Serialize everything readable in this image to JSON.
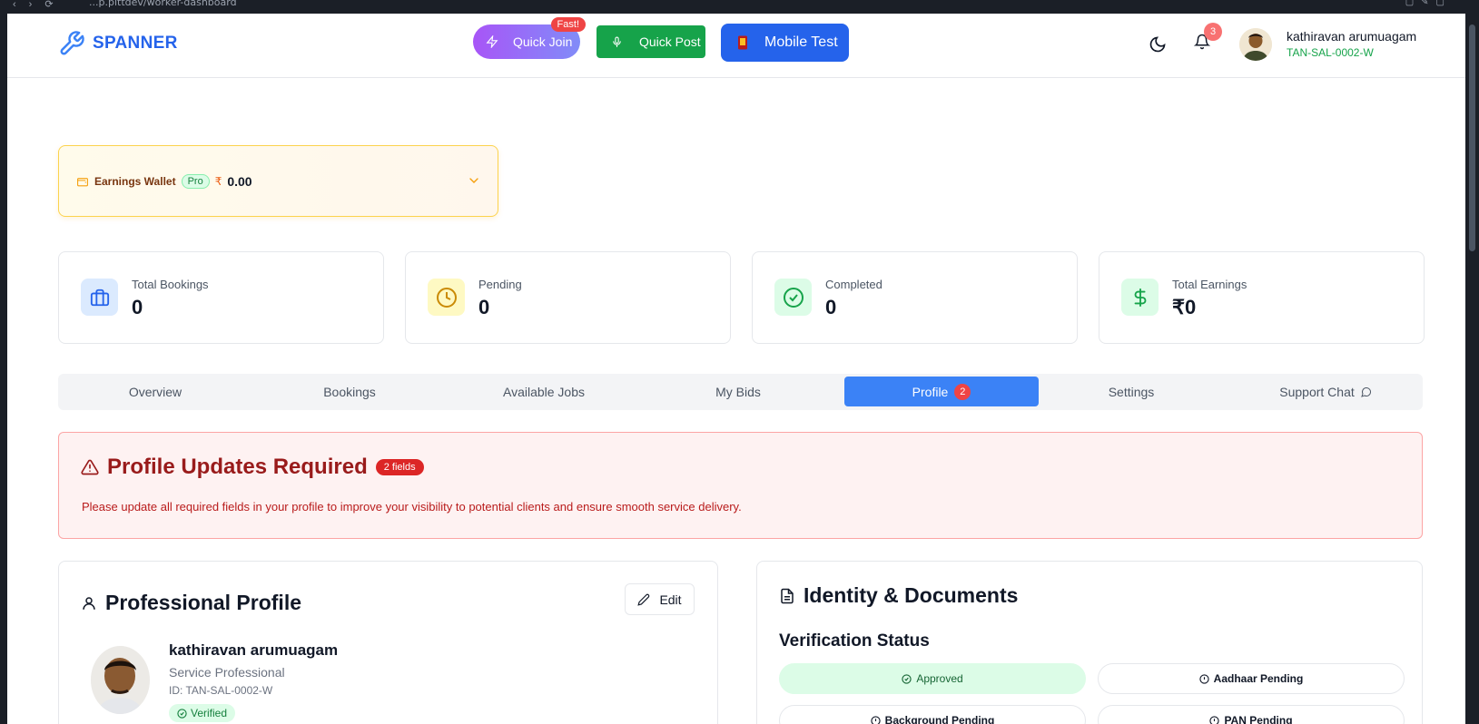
{
  "browser": {
    "url": "...p.pittdev/worker-dashboard"
  },
  "header": {
    "brand": "SPANNER",
    "quick_join": {
      "label": "Quick Join",
      "badge": "Fast!"
    },
    "quick_post": {
      "label": "Quick Post"
    },
    "mobile_test": {
      "label": "Mobile Test"
    },
    "notifications_count": "3",
    "user": {
      "name": "kathiravan arumuagam",
      "id": "TAN-SAL-0002-W"
    }
  },
  "wallet": {
    "label": "Earnings Wallet",
    "badge": "Pro",
    "currency": "₹",
    "amount": "0.00"
  },
  "stats": [
    {
      "label": "Total Bookings",
      "value": "0",
      "icon": "briefcase-icon",
      "color": "#2563eb"
    },
    {
      "label": "Pending",
      "value": "0",
      "icon": "clock-icon",
      "color": "#ca8a04"
    },
    {
      "label": "Completed",
      "value": "0",
      "icon": "check-circle-icon",
      "color": "#16a34a"
    },
    {
      "label": "Total Earnings",
      "value": "₹0",
      "icon": "dollar-icon",
      "color": "#16a34a"
    }
  ],
  "tabs": [
    {
      "label": "Overview"
    },
    {
      "label": "Bookings"
    },
    {
      "label": "Available Jobs"
    },
    {
      "label": "My Bids"
    },
    {
      "label": "Profile",
      "badge": "2",
      "active": true
    },
    {
      "label": "Settings"
    },
    {
      "label": "Support Chat"
    }
  ],
  "alert": {
    "title": "Profile Updates Required",
    "badge": "2 fields",
    "message": "Please update all required fields in your profile to improve your visibility to potential clients and ensure smooth service delivery."
  },
  "profile": {
    "heading": "Professional Profile",
    "edit_label": "Edit",
    "name": "kathiravan arumuagam",
    "role": "Service Professional",
    "id": "ID: TAN-SAL-0002-W",
    "verified": "Verified"
  },
  "documents": {
    "heading": "Identity & Documents",
    "subheading": "Verification Status",
    "statuses": [
      {
        "label": "Approved",
        "state": "ok"
      },
      {
        "label": "Aadhaar Pending",
        "state": "pending"
      },
      {
        "label": "Background Pending",
        "state": "pending"
      },
      {
        "label": "PAN Pending",
        "state": "pending"
      }
    ]
  },
  "colors": {
    "primary": "#2563eb",
    "success": "#16a34a",
    "danger": "#dc2626",
    "warning": "#f59e0b"
  }
}
